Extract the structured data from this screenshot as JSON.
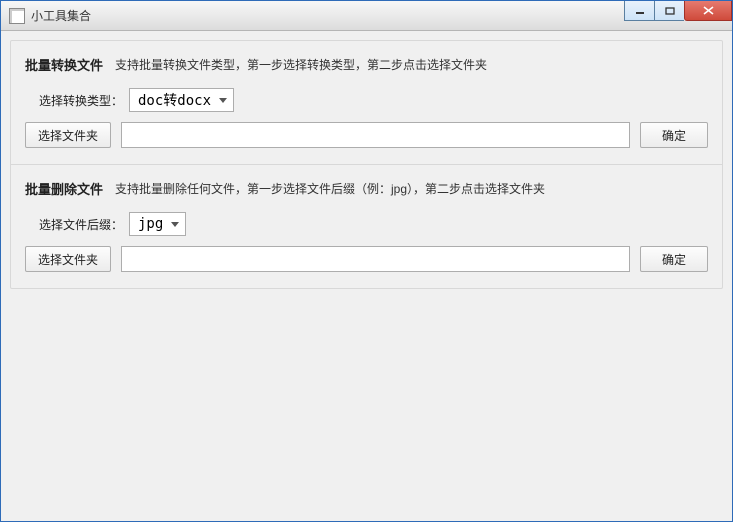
{
  "window": {
    "title": "小工具集合"
  },
  "section_convert": {
    "title": "批量转换文件",
    "desc": "支持批量转换文件类型，第一步选择转换类型，第二步点击选择文件夹",
    "type_label": "选择转换类型：",
    "type_value": "doc转docx",
    "choose_btn": "选择文件夹",
    "path_value": "",
    "confirm_btn": "确定"
  },
  "section_delete": {
    "title": "批量删除文件",
    "desc": "支持批量删除任何文件，第一步选择文件后缀（例：jpg），第二步点击选择文件夹",
    "suffix_label": "选择文件后缀：",
    "suffix_value": "jpg",
    "choose_btn": "选择文件夹",
    "path_value": "",
    "confirm_btn": "确定"
  }
}
